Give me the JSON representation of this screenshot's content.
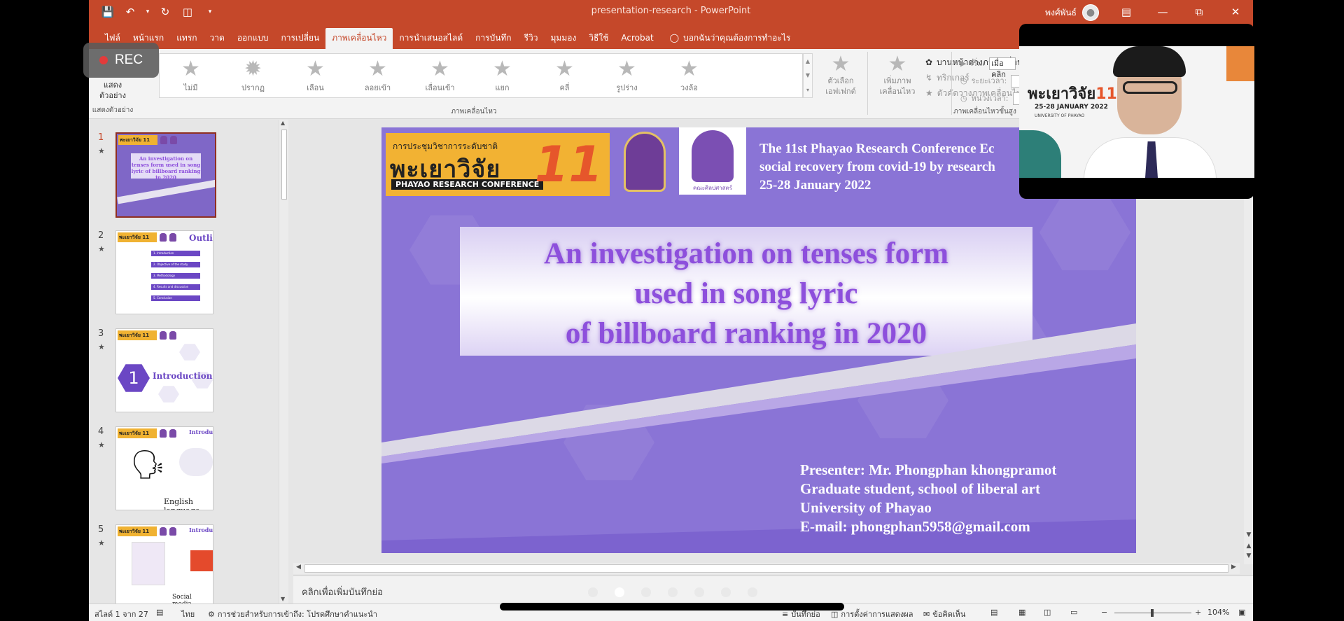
{
  "titlebar": {
    "doc_title": "presentation-research  -  PowerPoint",
    "user_name": "พงศ์พันธ์"
  },
  "tabs": [
    "ไฟล์",
    "หน้าแรก",
    "แทรก",
    "วาด",
    "ออกแบบ",
    "การเปลี่ยน",
    "ภาพเคลื่อนไหว",
    "การนำเสนอสไลด์",
    "การบันทึก",
    "รีวิว",
    "มุมมอง",
    "วิธีใช้",
    "Acrobat"
  ],
  "active_tab": "ภาพเคลื่อนไหว",
  "tell_me": "บอกฉันว่าคุณต้องการทำอะไร",
  "ribbon": {
    "preview_label": "แสดงตัวอย่าง",
    "preview_sub": "แสดง\nตัวอย่าง",
    "effects": [
      "ไม่มี",
      "ปรากฏ",
      "เลือน",
      "ลอยเข้า",
      "เลื่อนเข้า",
      "แยก",
      "คลี่",
      "รูปร่าง",
      "วงล้อ"
    ],
    "effect_options": "ตัวเลือกเอฟเฟกต์",
    "animation_group": "ภาพเคลื่อนไหว",
    "add_animation": "เพิ่มภาพเคลื่อนไหว",
    "animation_pane": "บานหน้าต่างภาพเคลื่อนไหว",
    "trigger": "ทริกเกอร์",
    "animation_painter": "ตัวคัดวางภาพเคลื่อนไหว",
    "advanced_group": "ภาพเคลื่อนไหวขั้นสูง",
    "start_label": "เริ่ม:",
    "start_value": "เมื่อคลิก",
    "duration_label": "ระยะเวลา:",
    "delay_label": "หน่วงเวลา:"
  },
  "slides_pane": [
    {
      "num": "1",
      "title": "An investigation on tenses form used in song lyric of billboard ranking in 2020"
    },
    {
      "num": "2",
      "title": "Outlines",
      "items": [
        "1. Introduction",
        "2. Objective of the study",
        "3. Methodology",
        "4. Results and discussion",
        "5. Conclusion"
      ]
    },
    {
      "num": "3",
      "title": "Introduction",
      "badge": "1"
    },
    {
      "num": "4",
      "title": "Introduction",
      "caption": "English language"
    },
    {
      "num": "5",
      "title": "Introduction",
      "caption": "Social media"
    }
  ],
  "slide": {
    "banner_sub": "การประชุมวิชาการระดับชาติ",
    "banner_big": "พะเยาวิจัย",
    "banner_eng": "PHAYAO RESEARCH CONFERENCE",
    "banner_num": "11",
    "seal2_caption": "คณะศิลปศาสตร์",
    "conf_line1": "The 11st Phayao Research Conference Ec",
    "conf_line2": "social recovery from covid-19 by research",
    "conf_line3": "25-28 January 2022",
    "title_line1": "An investigation on tenses form",
    "title_line2": "used in song lyric",
    "title_line3": "of billboard ranking in 2020",
    "presenter_line1": "Presenter: Mr. Phongphan khongpramot",
    "presenter_line2": "Graduate student, school of liberal art",
    "presenter_line3": "University of Phayao",
    "presenter_line4": "E-mail: phongphan5958@gmail.com"
  },
  "notes_placeholder": "คลิกเพื่อเพิ่มบันทึกย่อ",
  "statusbar": {
    "slide_info": "สไลด์ 1 จาก 27",
    "language": "ไทย",
    "accessibility": "การช่วยสำหรับการเข้าถึง: โปรดศึกษาคำแนะนำ",
    "notes": "บันทึกย่อ",
    "display_settings": "การตั้งค่าการแสดงผล",
    "comments": "ข้อคิดเห็น",
    "zoom": "104%"
  },
  "overlay": {
    "rec_label": "REC",
    "video_poster_title": "พะเยาวิจัย",
    "video_poster_num": "11",
    "video_poster_date": "25-28 JANUARY 2022",
    "video_poster_sub": "UNIVERSITY OF PHAYAO"
  },
  "colors": {
    "accent": "#c5482a",
    "slide_bg": "#8a74d6",
    "title_text": "#8d4fdc"
  }
}
